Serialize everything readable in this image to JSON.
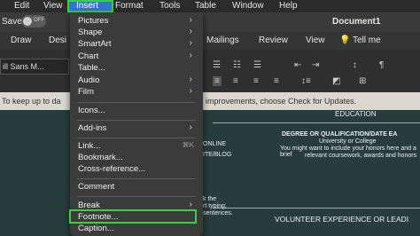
{
  "menubar": {
    "items": [
      "Edit",
      "View",
      "Insert",
      "Format",
      "Tools",
      "Table",
      "Window",
      "Help"
    ]
  },
  "titlebar": {
    "save_label": "Save",
    "toggle_label": "OFF",
    "title": "Document1"
  },
  "tabs": {
    "items": [
      "Draw",
      "Desi",
      "Mailings",
      "Review",
      "View"
    ],
    "tell_me": "Tell me"
  },
  "ribbon": {
    "font_name": "ill Sans M..."
  },
  "notice": {
    "left": "To keep up to da",
    "right": "improvements, choose Check for Updates."
  },
  "document": {
    "education_heading": "EDUCATION",
    "degree_line": "DEGREE OR QUALIFICATION/DATE EA",
    "university": "University or College",
    "detail1": "You might want to include your honors here and a brief",
    "detail2": "relevant coursework, awards and honors",
    "left1": "ONLINE",
    "left2": "ITE/BLOG",
    "left3": "k the",
    "left4": "rt typing.",
    "left5": "sentences.",
    "volunteer_heading": "VOLUNTEER EXPERIENCE OR LEADI"
  },
  "insert_menu": {
    "items": [
      {
        "label": "Pictures",
        "submenu": true
      },
      {
        "label": "Shape",
        "submenu": true
      },
      {
        "label": "SmartArt",
        "submenu": true
      },
      {
        "label": "Chart",
        "submenu": true
      },
      {
        "label": "Table...",
        "submenu": false
      },
      {
        "label": "Audio",
        "submenu": true
      },
      {
        "label": "Film",
        "submenu": true
      },
      {
        "label": "Icons...",
        "submenu": false
      },
      {
        "label": "Add-ins",
        "submenu": true
      },
      {
        "label": "Link...",
        "shortcut": "⌘K"
      },
      {
        "label": "Bookmark...",
        "submenu": false
      },
      {
        "label": "Cross-reference...",
        "submenu": false
      },
      {
        "label": "Comment",
        "submenu": false
      },
      {
        "label": "Break",
        "submenu": true
      },
      {
        "label": "Footnote...",
        "submenu": false
      },
      {
        "label": "Caption...",
        "submenu": false
      }
    ]
  },
  "colors": {
    "highlight_green": "#37d33a",
    "doc_bg": "#263d3b",
    "menu_bg": "#3b3b3b"
  }
}
